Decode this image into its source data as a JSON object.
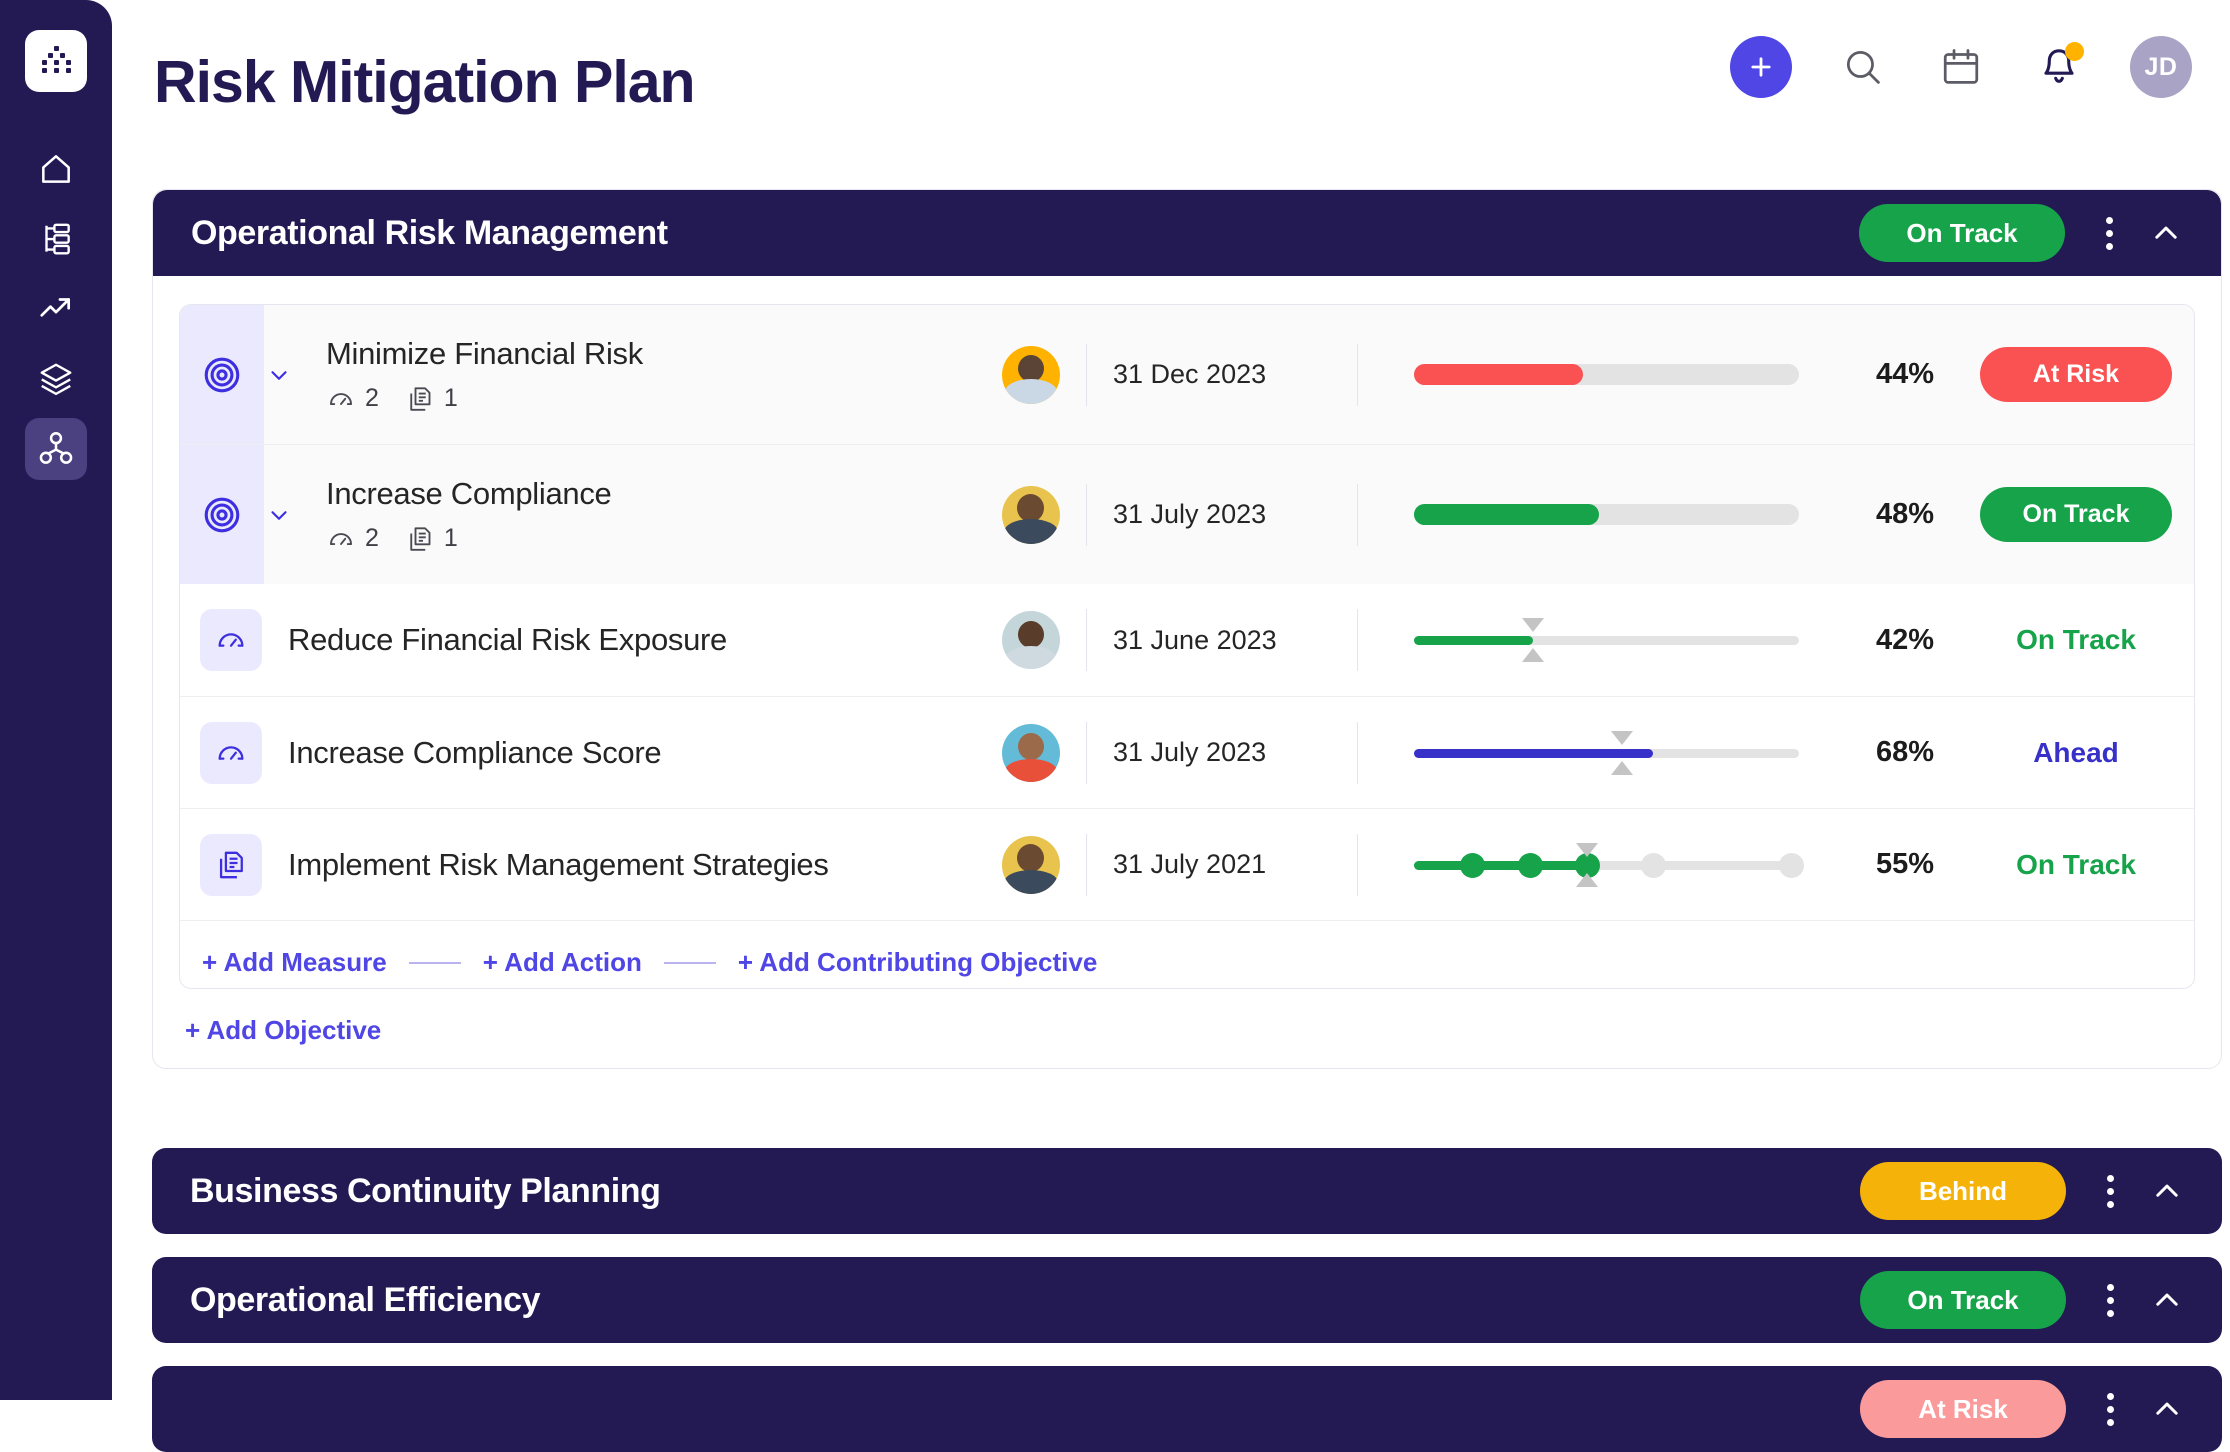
{
  "app": {
    "logo_icon": "dot-matrix-logo-icon",
    "sidebar_items": [
      {
        "icon": "home-icon",
        "name": "home",
        "active": false
      },
      {
        "icon": "org-tree-icon",
        "name": "plans",
        "active": false
      },
      {
        "icon": "trending-up-icon",
        "name": "performance",
        "active": false
      },
      {
        "icon": "layers-icon",
        "name": "layers",
        "active": false
      },
      {
        "icon": "network-icon",
        "name": "strategy-map",
        "active": true
      }
    ]
  },
  "header": {
    "title": "Risk Mitigation Plan",
    "actions": {
      "add_label": "+",
      "add_icon": "plus-icon",
      "search_icon": "search-icon",
      "calendar_icon": "calendar-icon",
      "notifications_icon": "bell-icon",
      "has_notification": true,
      "avatar_initials": "JD"
    }
  },
  "colors": {
    "brand_navy": "#231a54",
    "accent_purple": "#4f46e5",
    "green": "#16a34a",
    "amber": "#f5b208",
    "red": "#fa5252",
    "red_light": "#fb9a9a",
    "track_grey": "#e3e3e3"
  },
  "sections": [
    {
      "title": "Operational Risk Management",
      "status": "On Track",
      "status_type": "ontrack",
      "expanded": true,
      "objectives": [
        {
          "title": "Minimize Financial Risk",
          "icon": "target-icon",
          "measures_count": "2",
          "actions_count": "1",
          "due_date": "31 Dec 2023",
          "progress": 44,
          "progress_label": "44%",
          "bar_color": "#fa5252",
          "status": "At Risk",
          "status_type": "atrisk",
          "avatar": {
            "bg": "#ffb300",
            "skin": "#5b4435",
            "shirt": "#c9d8e4"
          }
        },
        {
          "title": "Increase Compliance",
          "icon": "target-icon",
          "measures_count": "2",
          "actions_count": "1",
          "due_date": "31 July 2023",
          "progress": 48,
          "progress_label": "48%",
          "bar_color": "#16a34a",
          "status": "On Track",
          "status_type": "ontrack",
          "avatar": {
            "bg": "#e8c44e",
            "skin": "#6b4a32",
            "shirt": "#3b4a5c"
          }
        }
      ],
      "children": [
        {
          "title": "Reduce Financial Risk Exposure",
          "type": "measure",
          "icon": "gauge-icon",
          "due_date": "31 June 2023",
          "progress": 31,
          "marker": 31,
          "progress_label": "42%",
          "bar_color": "#16a34a",
          "status": "On Track",
          "status_type": "ontrack",
          "status_color": "#16a34a",
          "avatar": {
            "bg": "#c5d6da",
            "skin": "#5a3c2a",
            "shirt": "#cfd9e0"
          }
        },
        {
          "title": "Increase Compliance Score",
          "type": "measure",
          "icon": "gauge-icon",
          "due_date": "31 July 2023",
          "progress": 62,
          "marker": 54,
          "progress_label": "68%",
          "bar_color": "#3730c9",
          "status": "Ahead",
          "status_type": "ahead",
          "status_color": "#3730c9",
          "avatar": {
            "bg": "#63bbd8",
            "skin": "#9a6a4a",
            "shirt": "#e8503a"
          }
        },
        {
          "title": "Implement Risk Management Strategies",
          "type": "action",
          "icon": "document-icon",
          "due_date": "31 July 2021",
          "progress": 45,
          "marker": 45,
          "progress_label": "55%",
          "bar_color": "#16a34a",
          "status": "On Track",
          "status_type": "ontrack",
          "status_color": "#16a34a",
          "milestones": [
            {
              "pos": 15,
              "done": true
            },
            {
              "pos": 30,
              "done": true
            },
            {
              "pos": 45,
              "done": true
            },
            {
              "pos": 62,
              "done": false
            },
            {
              "pos": 98,
              "done": false
            }
          ],
          "avatar": {
            "bg": "#e8c44e",
            "skin": "#6b4a32",
            "shirt": "#3b4a5c"
          }
        }
      ],
      "add_links": [
        "+ Add Measure",
        "+ Add Action",
        "+ Add Contributing Objective"
      ],
      "add_objective_label": "+ Add Objective"
    },
    {
      "title": "Business Continuity Planning",
      "status": "Behind",
      "status_type": "behind",
      "expanded": false
    },
    {
      "title": "Operational Efficiency",
      "status": "On Track",
      "status_type": "ontrack",
      "expanded": false
    },
    {
      "title": "",
      "status": "At Risk",
      "status_type": "atrisk-light",
      "expanded": false
    }
  ]
}
